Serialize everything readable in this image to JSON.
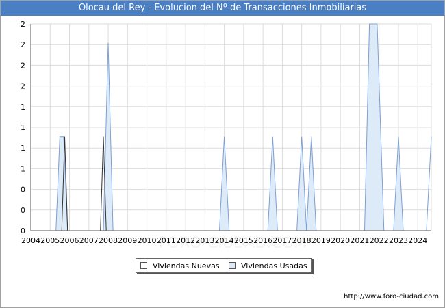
{
  "chart_data": {
    "type": "area",
    "title": "Olocau del Rey - Evolucion del Nº de Transacciones Inmobiliarias",
    "x_ticks": [
      "2004",
      "2005",
      "2006",
      "2007",
      "2008",
      "2009",
      "2010",
      "2011",
      "2012",
      "2013",
      "2014",
      "2015",
      "2016",
      "2017",
      "2018",
      "2019",
      "2020",
      "2021",
      "2022",
      "2023",
      "2024"
    ],
    "y_ticks": [
      "0",
      "0",
      "0",
      "1",
      "1",
      "1",
      "1",
      "2",
      "2",
      "2",
      "2"
    ],
    "ylim": [
      0,
      2.2
    ],
    "xlim": [
      2004,
      2024.7
    ],
    "grid": true,
    "legend_position": "bottom",
    "colors": {
      "nuevas_fill": "#ffffff",
      "nuevas_line": "#333333",
      "usadas_fill": "#ddeaf7",
      "usadas_line": "#7c9fd4",
      "grid": "#dcdcdc",
      "title_bg": "#4b7fc4"
    },
    "series": [
      {
        "name": "Viviendas Nuevas",
        "points": [
          [
            2005.6,
            0
          ],
          [
            2005.75,
            1
          ],
          [
            2005.9,
            0
          ],
          [
            2007.6,
            0
          ],
          [
            2007.75,
            1
          ],
          [
            2007.9,
            0
          ]
        ]
      },
      {
        "name": "Viviendas Usadas",
        "points": [
          [
            2005.3,
            0
          ],
          [
            2005.5,
            1
          ],
          [
            2005.7,
            1
          ],
          [
            2005.9,
            0
          ],
          [
            2007.75,
            0
          ],
          [
            2008.0,
            2
          ],
          [
            2008.25,
            0
          ],
          [
            2013.75,
            0
          ],
          [
            2014.0,
            1
          ],
          [
            2014.25,
            0
          ],
          [
            2016.25,
            0
          ],
          [
            2016.5,
            1
          ],
          [
            2016.75,
            0
          ],
          [
            2017.75,
            0
          ],
          [
            2018.0,
            1
          ],
          [
            2018.25,
            0
          ],
          [
            2018.25,
            0
          ],
          [
            2018.5,
            1
          ],
          [
            2018.75,
            0
          ],
          [
            2021.25,
            0
          ],
          [
            2021.5,
            2.2
          ],
          [
            2021.9,
            2.2
          ],
          [
            2022.25,
            0
          ],
          [
            2022.75,
            0
          ],
          [
            2023.0,
            1
          ],
          [
            2023.25,
            0
          ],
          [
            2024.45,
            0
          ],
          [
            2024.7,
            1
          ]
        ]
      }
    ]
  },
  "source": "http://www.foro-ciudad.com",
  "watermark": "FORO-CIUDAD.COM"
}
